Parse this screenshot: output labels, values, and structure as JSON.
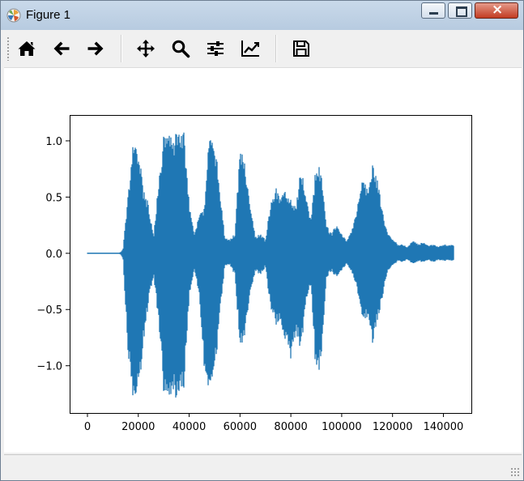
{
  "window": {
    "title": "Figure 1"
  },
  "toolbar": {
    "buttons": [
      {
        "id": "home",
        "icon": "home-icon"
      },
      {
        "id": "back",
        "icon": "arrow-left-icon"
      },
      {
        "id": "forward",
        "icon": "arrow-right-icon"
      },
      {
        "id": "pan",
        "icon": "move-icon"
      },
      {
        "id": "zoom",
        "icon": "magnifier-icon"
      },
      {
        "id": "subplots",
        "icon": "sliders-icon"
      },
      {
        "id": "customize",
        "icon": "line-chart-icon"
      },
      {
        "id": "save",
        "icon": "floppy-disk-icon"
      }
    ]
  },
  "chart_data": {
    "type": "line",
    "title": "",
    "xlabel": "",
    "ylabel": "",
    "xlim": [
      -7000,
      151000
    ],
    "ylim": [
      -1.42,
      1.23
    ],
    "xticks": [
      0,
      20000,
      40000,
      60000,
      80000,
      100000,
      120000,
      140000
    ],
    "xtick_labels": [
      "0",
      "20000",
      "40000",
      "60000",
      "80000",
      "100000",
      "120000",
      "140000"
    ],
    "yticks": [
      1.0,
      0.5,
      0.0,
      -0.5,
      -1.0
    ],
    "ytick_labels": [
      "1.0",
      "0.5",
      "0.0",
      "−0.5",
      "−1.0"
    ],
    "grid": false,
    "color": "#1f77b4",
    "series": [
      {
        "description_envelope": "upper and lower amplitude envelope of audio waveform, sampled every 2000 samples",
        "x": [
          0,
          2000,
          4000,
          6000,
          8000,
          10000,
          12000,
          13000,
          14000,
          16000,
          18000,
          20000,
          22000,
          24000,
          26000,
          28000,
          30000,
          32000,
          34000,
          36000,
          38000,
          40000,
          42000,
          44000,
          46000,
          48000,
          50000,
          52000,
          54000,
          56000,
          58000,
          60000,
          62000,
          64000,
          66000,
          68000,
          70000,
          72000,
          74000,
          76000,
          78000,
          80000,
          82000,
          84000,
          86000,
          88000,
          90000,
          92000,
          94000,
          96000,
          98000,
          100000,
          102000,
          104000,
          106000,
          108000,
          110000,
          112000,
          114000,
          116000,
          118000,
          120000,
          122000,
          124000,
          126000,
          128000,
          130000,
          132000,
          134000,
          136000,
          138000,
          140000,
          142000,
          144000
        ],
        "upper": [
          0.0,
          0.0,
          0.0,
          0.0,
          0.0,
          0.0,
          0.0,
          0.01,
          0.04,
          0.55,
          1.0,
          0.95,
          0.58,
          0.45,
          0.15,
          0.65,
          1.08,
          1.1,
          1.05,
          1.12,
          1.1,
          0.45,
          0.18,
          0.35,
          0.4,
          1.08,
          1.0,
          0.62,
          0.15,
          0.12,
          0.18,
          0.95,
          0.82,
          0.42,
          0.15,
          0.18,
          0.12,
          0.45,
          0.6,
          0.5,
          0.58,
          0.48,
          0.42,
          0.78,
          0.48,
          0.32,
          0.82,
          0.75,
          0.25,
          0.18,
          0.26,
          0.18,
          0.12,
          0.22,
          0.38,
          0.72,
          0.58,
          0.8,
          0.68,
          0.38,
          0.18,
          0.14,
          0.08,
          0.08,
          0.06,
          0.12,
          0.08,
          0.1,
          0.07,
          0.08,
          0.06,
          0.08,
          0.07,
          0.08
        ],
        "lower": [
          0.0,
          0.0,
          0.0,
          0.0,
          0.0,
          0.0,
          0.0,
          -0.01,
          -0.05,
          -0.95,
          -1.32,
          -1.28,
          -0.82,
          -0.45,
          -0.2,
          -0.62,
          -1.28,
          -1.32,
          -1.3,
          -1.3,
          -1.22,
          -0.4,
          -0.15,
          -0.38,
          -1.05,
          -1.22,
          -1.1,
          -0.6,
          -0.12,
          -0.1,
          -0.2,
          -0.85,
          -0.75,
          -0.35,
          -0.16,
          -0.2,
          -0.12,
          -0.5,
          -0.65,
          -0.62,
          -0.82,
          -0.95,
          -0.72,
          -0.88,
          -0.4,
          -0.3,
          -1.15,
          -0.98,
          -0.22,
          -0.16,
          -0.22,
          -0.16,
          -0.1,
          -0.18,
          -0.3,
          -0.62,
          -0.58,
          -0.82,
          -0.62,
          -0.4,
          -0.16,
          -0.12,
          -0.07,
          -0.08,
          -0.06,
          -0.1,
          -0.07,
          -0.08,
          -0.06,
          -0.08,
          -0.06,
          -0.07,
          -0.06,
          -0.07
        ]
      }
    ]
  }
}
